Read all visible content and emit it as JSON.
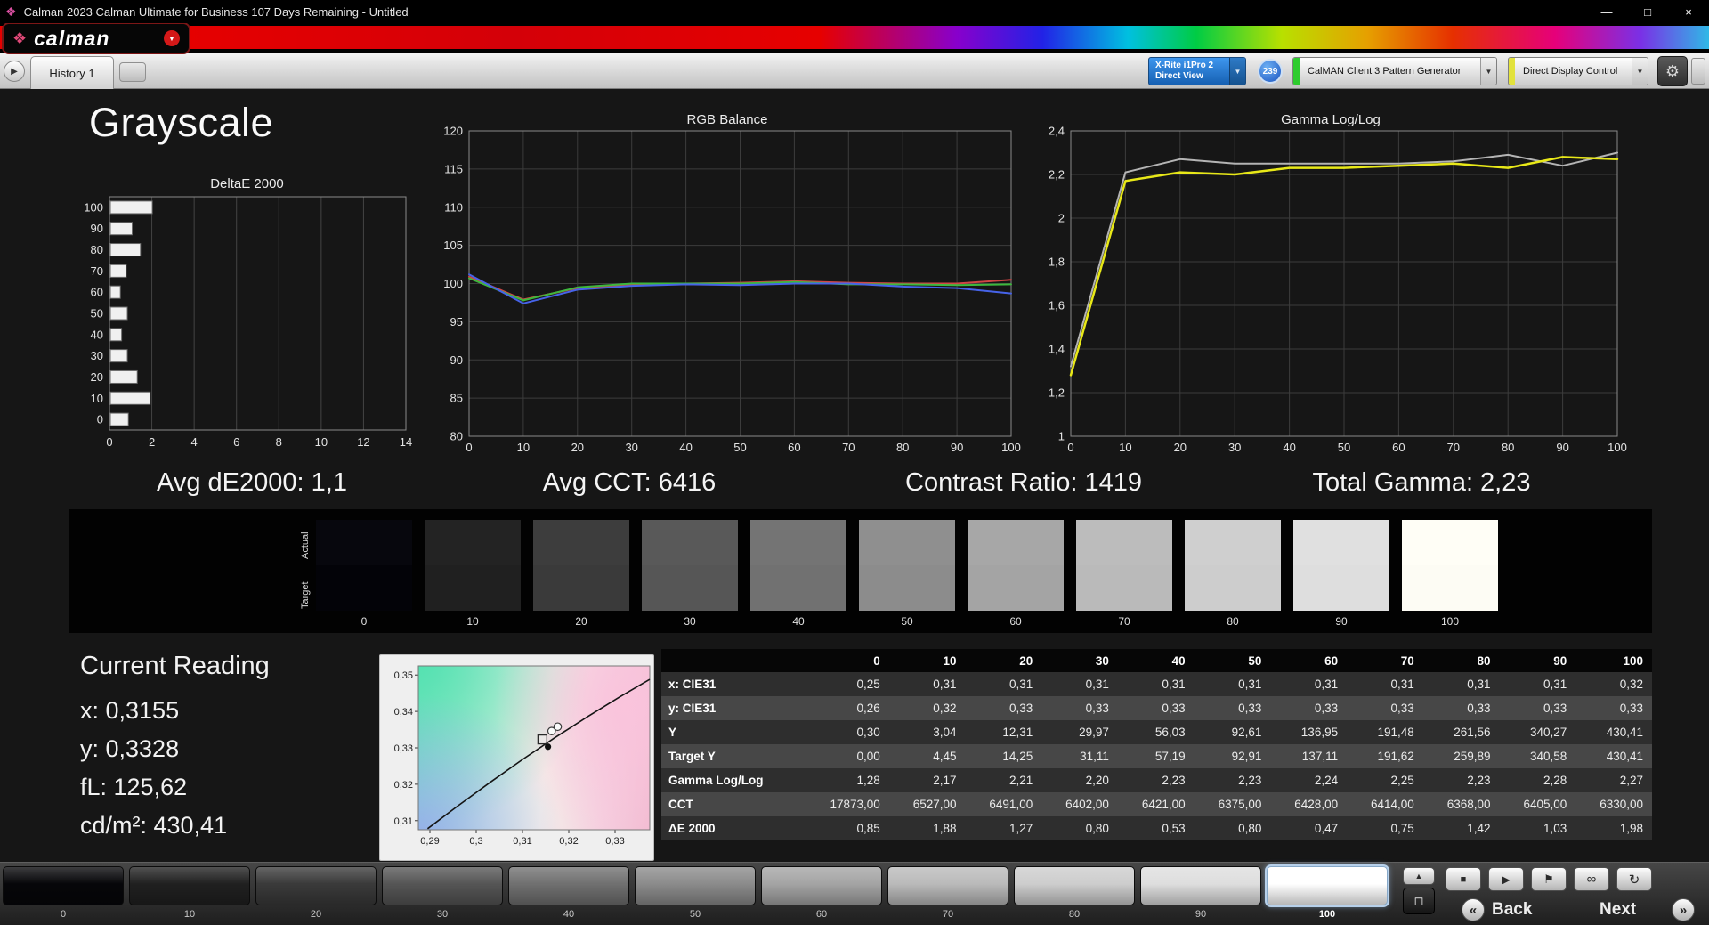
{
  "window": {
    "title": "Calman 2023 Calman Ultimate for Business 107 Days Remaining  - Untitled"
  },
  "icons": {
    "app": "❖",
    "logo_mark": "❖",
    "logo_caret": "▼",
    "nav_arrow": "▶",
    "dropdown_arrow": "▼",
    "gear": "⚙",
    "minimize": "—",
    "maximize": "□",
    "close": "×",
    "eject": "▲",
    "panel": "◻",
    "stop": "■",
    "play": "▶",
    "save": "⚑",
    "loop": "∞",
    "refresh": "↻",
    "back": "«",
    "next": "»"
  },
  "brand": {
    "logo_text": "calman"
  },
  "tabbar": {
    "tab": "History 1",
    "meter_line1": "X-Rite i1Pro 2",
    "meter_line2": "Direct View",
    "badge": "239",
    "pattern_generator": "CalMAN Client 3 Pattern Generator",
    "display_control": "Direct Display Control"
  },
  "page": {
    "title": "Grayscale"
  },
  "stats": [
    {
      "text": "Avg dE2000: 1,1"
    },
    {
      "text": "Avg CCT: 6416"
    },
    {
      "text": "Contrast Ratio: 1419"
    },
    {
      "text": "Total Gamma: 2,23"
    }
  ],
  "swatch_strip": {
    "actual_label": "Actual",
    "target_label": "Target",
    "swatches": [
      {
        "level": "0",
        "actual": "#07070d",
        "target": "#030308"
      },
      {
        "level": "10",
        "actual": "#232323",
        "target": "#202020"
      },
      {
        "level": "20",
        "actual": "#3d3d3d",
        "target": "#3a3a3a"
      },
      {
        "level": "30",
        "actual": "#595959",
        "target": "#565656"
      },
      {
        "level": "40",
        "actual": "#747474",
        "target": "#717171"
      },
      {
        "level": "50",
        "actual": "#8f8f8f",
        "target": "#8c8c8c"
      },
      {
        "level": "60",
        "actual": "#a7a7a7",
        "target": "#a4a4a4"
      },
      {
        "level": "70",
        "actual": "#bcbcbc",
        "target": "#bababa"
      },
      {
        "level": "80",
        "actual": "#cfcfcf",
        "target": "#cdcdcd"
      },
      {
        "level": "90",
        "actual": "#e0e0e0",
        "target": "#dedede"
      },
      {
        "level": "100",
        "actual": "#fffef6",
        "target": "#fdfcf4"
      }
    ]
  },
  "current_reading": {
    "title": "Current Reading",
    "lines": [
      "x: 0,3155",
      "y: 0,3328",
      "fL: 125,62",
      "cd/m²: 430,41"
    ]
  },
  "table": {
    "columns": [
      "",
      "0",
      "10",
      "20",
      "30",
      "40",
      "50",
      "60",
      "70",
      "80",
      "90",
      "100"
    ],
    "rows": [
      {
        "label": "x: CIE31",
        "values": [
          "0,25",
          "0,31",
          "0,31",
          "0,31",
          "0,31",
          "0,31",
          "0,31",
          "0,31",
          "0,31",
          "0,31",
          "0,32"
        ]
      },
      {
        "label": "y: CIE31",
        "values": [
          "0,26",
          "0,32",
          "0,33",
          "0,33",
          "0,33",
          "0,33",
          "0,33",
          "0,33",
          "0,33",
          "0,33",
          "0,33"
        ]
      },
      {
        "label": "Y",
        "values": [
          "0,30",
          "3,04",
          "12,31",
          "29,97",
          "56,03",
          "92,61",
          "136,95",
          "191,48",
          "261,56",
          "340,27",
          "430,41"
        ]
      },
      {
        "label": "Target Y",
        "values": [
          "0,00",
          "4,45",
          "14,25",
          "31,11",
          "57,19",
          "92,91",
          "137,11",
          "191,62",
          "259,89",
          "340,58",
          "430,41"
        ]
      },
      {
        "label": "Gamma Log/Log",
        "values": [
          "1,28",
          "2,17",
          "2,21",
          "2,20",
          "2,23",
          "2,23",
          "2,24",
          "2,25",
          "2,23",
          "2,28",
          "2,27"
        ]
      },
      {
        "label": "CCT",
        "values": [
          "17873,00",
          "6527,00",
          "6491,00",
          "6402,00",
          "6421,00",
          "6375,00",
          "6428,00",
          "6414,00",
          "6368,00",
          "6405,00",
          "6330,00"
        ]
      },
      {
        "label": "ΔE 2000",
        "values": [
          "0,85",
          "1,88",
          "1,27",
          "0,80",
          "0,53",
          "0,80",
          "0,47",
          "0,75",
          "1,42",
          "1,03",
          "1,98"
        ]
      }
    ]
  },
  "bottom": {
    "patches": [
      {
        "level": "0",
        "color": "#060609"
      },
      {
        "level": "10",
        "color": "#202020"
      },
      {
        "level": "20",
        "color": "#3a3a3a"
      },
      {
        "level": "30",
        "color": "#555555"
      },
      {
        "level": "40",
        "color": "#707070"
      },
      {
        "level": "50",
        "color": "#8b8b8b"
      },
      {
        "level": "60",
        "color": "#a4a4a4"
      },
      {
        "level": "70",
        "color": "#bababa"
      },
      {
        "level": "80",
        "color": "#cdcdcd"
      },
      {
        "level": "90",
        "color": "#dedede"
      },
      {
        "level": "100",
        "color": "#ffffff",
        "selected": true
      }
    ],
    "back_label": "Back",
    "next_label": "Next"
  },
  "theme": {
    "stripe_green": "#2ecc2e",
    "stripe_yellow": "#e2e23c",
    "meter_blue": "linear-gradient(#3e96ee,#1660b2)",
    "badge_blue": "radial-gradient(circle at 35% 30%, #6db0f4, #1c55c0)"
  },
  "chart_data": [
    {
      "name": "deltae2000",
      "type": "bar",
      "orientation": "horizontal",
      "title": "DeltaE 2000",
      "categories": [
        "0",
        "10",
        "20",
        "30",
        "40",
        "50",
        "60",
        "70",
        "80",
        "90",
        "100"
      ],
      "values": [
        0.85,
        1.88,
        1.27,
        0.8,
        0.53,
        0.8,
        0.47,
        0.75,
        1.42,
        1.03,
        1.98
      ],
      "xlim": [
        0,
        14
      ],
      "xticks": [
        0,
        2,
        4,
        6,
        8,
        10,
        12,
        14
      ],
      "xtick_labels": [
        "0",
        "2",
        "4",
        "6",
        "8",
        "10",
        "12",
        "14"
      ],
      "bar_color": "#f0f0f0",
      "grid": true,
      "legend": "none"
    },
    {
      "name": "rgb_balance",
      "type": "line",
      "title": "RGB Balance",
      "x": [
        0,
        10,
        20,
        30,
        40,
        50,
        60,
        70,
        80,
        90,
        100
      ],
      "xtick_labels": [
        "0",
        "10",
        "20",
        "30",
        "40",
        "50",
        "60",
        "70",
        "80",
        "90",
        "100"
      ],
      "ylim": [
        80,
        120
      ],
      "yticks": [
        80,
        85,
        90,
        95,
        100,
        105,
        110,
        115,
        120
      ],
      "ytick_labels": [
        "80",
        "85",
        "90",
        "95",
        "100",
        "105",
        "110",
        "115",
        "120"
      ],
      "grid": true,
      "legend": "none",
      "series": [
        {
          "name": "Red",
          "color": "#d04545",
          "values": [
            100.9,
            97.9,
            99.4,
            99.9,
            100.0,
            100.1,
            100.3,
            100.1,
            100.0,
            100.0,
            100.5
          ]
        },
        {
          "name": "Green",
          "color": "#3db83d",
          "values": [
            100.7,
            97.8,
            99.5,
            100.0,
            100.0,
            100.0,
            100.2,
            99.9,
            99.9,
            99.8,
            99.9
          ]
        },
        {
          "name": "Blue",
          "color": "#4663e8",
          "values": [
            101.2,
            97.4,
            99.2,
            99.7,
            99.9,
            99.8,
            100.0,
            100.0,
            99.6,
            99.4,
            98.7
          ]
        }
      ]
    },
    {
      "name": "gamma_loglog",
      "type": "line",
      "title": "Gamma Log/Log",
      "x": [
        0,
        10,
        20,
        30,
        40,
        50,
        60,
        70,
        80,
        90,
        100
      ],
      "xtick_labels": [
        "0",
        "10",
        "20",
        "30",
        "40",
        "50",
        "60",
        "70",
        "80",
        "90",
        "100"
      ],
      "ylim": [
        1,
        2.4
      ],
      "yticks": [
        1,
        1.2,
        1.4,
        1.6,
        1.8,
        2,
        2.2,
        2.4
      ],
      "ytick_labels": [
        "1",
        "1,2",
        "1,4",
        "1,6",
        "1,8",
        "2",
        "2,2",
        "2,4"
      ],
      "grid": true,
      "legend": "none",
      "series": [
        {
          "name": "Target",
          "color": "#b4b4b4",
          "width": 2,
          "values": [
            1.32,
            2.21,
            2.27,
            2.25,
            2.25,
            2.25,
            2.25,
            2.26,
            2.29,
            2.24,
            2.3
          ]
        },
        {
          "name": "Measured",
          "color": "#e8e818",
          "width": 2.5,
          "values": [
            1.28,
            2.17,
            2.21,
            2.2,
            2.23,
            2.23,
            2.24,
            2.25,
            2.23,
            2.28,
            2.27
          ]
        }
      ]
    },
    {
      "name": "cie_chromaticity",
      "type": "scatter",
      "title": "CIE 1931 chromaticity detail",
      "xlim": [
        0.2875,
        0.3375
      ],
      "ylim": [
        0.3075,
        0.3525
      ],
      "xticks": [
        0.29,
        0.3,
        0.31,
        0.32,
        0.33
      ],
      "xtick_labels": [
        "0,29",
        "0,3",
        "0,31",
        "0,32",
        "0,33"
      ],
      "yticks": [
        0.31,
        0.32,
        0.33,
        0.34,
        0.35
      ],
      "ytick_labels": [
        "0,31",
        "0,32",
        "0,33",
        "0,34",
        "0,35"
      ],
      "locus": [
        [
          0.2895,
          0.3078
        ],
        [
          0.296,
          0.314
        ],
        [
          0.303,
          0.3205
        ],
        [
          0.31,
          0.3268
        ],
        [
          0.317,
          0.3328
        ],
        [
          0.324,
          0.3385
        ],
        [
          0.331,
          0.344
        ],
        [
          0.3375,
          0.3488
        ]
      ],
      "markers": {
        "squares": [
          [
            0.3143,
            0.3323
          ]
        ],
        "circles": [
          [
            0.3163,
            0.3346
          ],
          [
            0.3176,
            0.3358
          ]
        ],
        "dots": [
          [
            0.3155,
            0.3303
          ]
        ]
      }
    }
  ]
}
